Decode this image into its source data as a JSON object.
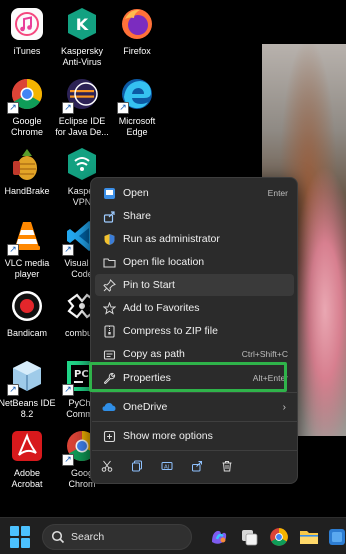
{
  "desktop": {
    "icons": [
      {
        "label": "iTunes",
        "icon": "itunes-icon",
        "shortcut": false
      },
      {
        "label": "Kaspersky\nAnti-Virus",
        "icon": "kaspersky-icon",
        "shortcut": false
      },
      {
        "label": "Firefox",
        "icon": "firefox-icon",
        "shortcut": false
      },
      {
        "label": "Google\nChrome",
        "icon": "chrome-icon",
        "shortcut": true
      },
      {
        "label": "Eclipse IDE\nfor Java De...",
        "icon": "eclipse-icon",
        "shortcut": true
      },
      {
        "label": "Microsoft\nEdge",
        "icon": "edge-icon",
        "shortcut": true
      },
      {
        "label": "HandBrake",
        "icon": "handbrake-icon",
        "shortcut": false
      },
      {
        "label": "Kasper\nVPN",
        "icon": "kaspersky-vpn-icon",
        "shortcut": false
      },
      {
        "label": "VLC media\nplayer",
        "icon": "vlc-icon",
        "shortcut": true
      },
      {
        "label": "Visual St\nCode",
        "icon": "vscode-icon",
        "shortcut": true
      },
      {
        "label": "Bandicam",
        "icon": "bandicam-icon",
        "shortcut": false
      },
      {
        "label": "combust",
        "icon": "combust-icon",
        "shortcut": false
      },
      {
        "label": "NetBeans IDE\n8.2",
        "icon": "netbeans-icon",
        "shortcut": true
      },
      {
        "label": "PyCha\nCommu",
        "icon": "pycharm-icon",
        "shortcut": true
      },
      {
        "label": "Adobe\nAcrobat",
        "icon": "acrobat-icon",
        "shortcut": false
      },
      {
        "label": "Goog\nChrom",
        "icon": "chrome-icon",
        "shortcut": true
      }
    ]
  },
  "context_menu": {
    "items": [
      {
        "label": "Open",
        "shortcut": "Enter",
        "icon": "open-app-icon"
      },
      {
        "label": "Share",
        "shortcut": "",
        "icon": "share-icon"
      },
      {
        "label": "Run as administrator",
        "shortcut": "",
        "icon": "shield-icon"
      },
      {
        "label": "Open file location",
        "shortcut": "",
        "icon": "folder-icon"
      },
      {
        "label": "Pin to Start",
        "shortcut": "",
        "icon": "pin-icon"
      },
      {
        "label": "Add to Favorites",
        "shortcut": "",
        "icon": "star-icon"
      },
      {
        "label": "Compress to ZIP file",
        "shortcut": "",
        "icon": "zip-icon"
      },
      {
        "label": "Copy as path",
        "shortcut": "Ctrl+Shift+C",
        "icon": "copy-path-icon"
      },
      {
        "label": "Properties",
        "shortcut": "Alt+Enter",
        "icon": "wrench-icon"
      },
      {
        "label": "OneDrive",
        "shortcut": "",
        "icon": "onedrive-icon",
        "submenu": true
      },
      {
        "label": "Show more options",
        "shortcut": "",
        "icon": "more-options-icon"
      }
    ],
    "hovered_item": "Pin to Start",
    "highlighted_item": "Properties",
    "highlight_color": "#2fb34a",
    "bottom_actions": [
      "cut-icon",
      "copy-icon",
      "rename-icon",
      "share-icon",
      "delete-icon"
    ]
  },
  "taskbar": {
    "search_placeholder": "Search",
    "accent": "#4cc2ff",
    "apps": [
      "copilot-icon",
      "widget-icon",
      "chrome-icon",
      "file-explorer-icon",
      "app-icon"
    ]
  }
}
